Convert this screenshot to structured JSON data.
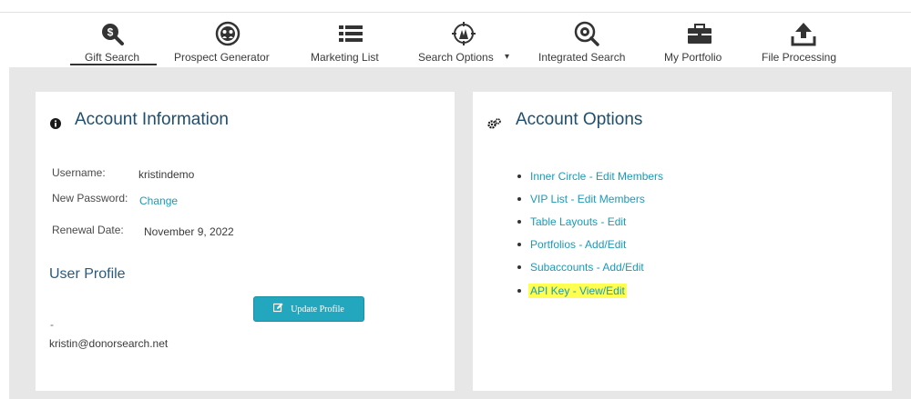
{
  "nav": {
    "items": [
      {
        "label": "Gift Search",
        "icon": "gift-search-icon"
      },
      {
        "label": "Prospect Generator",
        "icon": "prospect-generator-icon"
      },
      {
        "label": "Marketing List",
        "icon": "marketing-list-icon"
      },
      {
        "label": "Search Options",
        "icon": "search-options-icon",
        "caret": "▾"
      },
      {
        "label": "Integrated Search",
        "icon": "integrated-search-icon"
      },
      {
        "label": "My Portfolio",
        "icon": "briefcase-icon"
      },
      {
        "label": "File Processing",
        "icon": "upload-icon"
      }
    ],
    "active": "Gift Search"
  },
  "account_info": {
    "title": "Account Information",
    "username_label": "Username:",
    "username": "kristindemo",
    "password_label": "New Password:",
    "password_link": "Change",
    "renewal_label": "Renewal Date:",
    "renewal_date": "November 9, 2022",
    "profile_title": "User Profile",
    "profile_dash": "-",
    "email": "kristin@donorsearch.net",
    "update_button": "Update Profile"
  },
  "account_options": {
    "title": "Account Options",
    "items": [
      {
        "label": "Inner Circle - Edit Members"
      },
      {
        "label": "VIP List - Edit Members"
      },
      {
        "label": "Table Layouts - Edit"
      },
      {
        "label": "Portfolios - Add/Edit"
      },
      {
        "label": "Subaccounts - Add/Edit"
      },
      {
        "label": "API Key - View/Edit",
        "highlighted": true
      }
    ]
  },
  "colors": {
    "accent": "#1a9ab8",
    "title": "#1f4e6e",
    "button": "#23a7be",
    "highlight": "#ffff52"
  }
}
